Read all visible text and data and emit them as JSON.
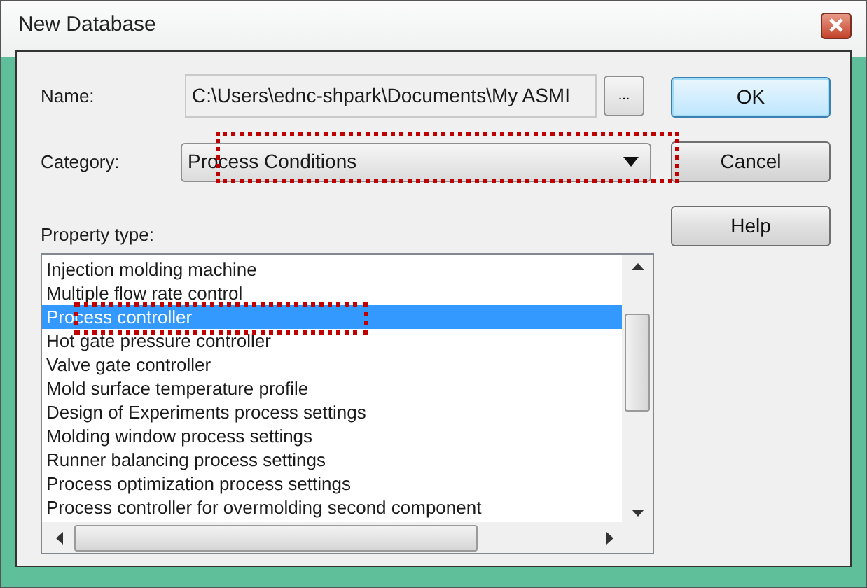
{
  "window": {
    "title": "New Database"
  },
  "name_field": {
    "label": "Name:",
    "value": "C:\\Users\\ednc-shpark\\Documents\\My ASMI",
    "browse": "..."
  },
  "category": {
    "label": "Category:",
    "value": "Process Conditions",
    "highlighted": true
  },
  "property_type": {
    "label": "Property type:",
    "items": [
      {
        "text": "Injection molding machine",
        "selected": false,
        "highlighted": false
      },
      {
        "text": "Multiple flow rate control",
        "selected": false,
        "highlighted": false
      },
      {
        "text": "Process controller",
        "selected": true,
        "highlighted": true
      },
      {
        "text": "Hot gate pressure controller",
        "selected": false,
        "highlighted": false
      },
      {
        "text": "Valve gate controller",
        "selected": false,
        "highlighted": false
      },
      {
        "text": "Mold surface temperature profile",
        "selected": false,
        "highlighted": false
      },
      {
        "text": "Design of Experiments process settings",
        "selected": false,
        "highlighted": false
      },
      {
        "text": "Molding window process settings",
        "selected": false,
        "highlighted": false
      },
      {
        "text": "Runner balancing process settings",
        "selected": false,
        "highlighted": false
      },
      {
        "text": "Process optimization process settings",
        "selected": false,
        "highlighted": false
      },
      {
        "text": "Process controller for overmolding second component",
        "selected": false,
        "highlighted": false
      }
    ]
  },
  "buttons": [
    {
      "label": "OK",
      "default": true
    },
    {
      "label": "Cancel",
      "default": false
    },
    {
      "label": "Help",
      "default": false
    }
  ]
}
